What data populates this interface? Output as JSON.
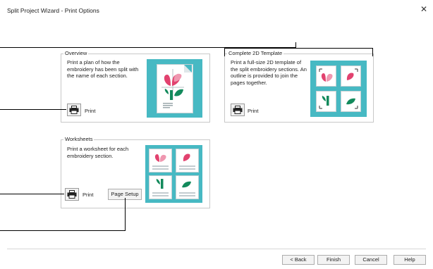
{
  "window": {
    "title": "Split Project Wizard - Print Options",
    "close_glyph": "✕"
  },
  "overview": {
    "label": "Overview",
    "description": "Print a plan of how the embroidery has been split with the name of each section.",
    "print_label": "Print",
    "icon": "printer-icon"
  },
  "template2d": {
    "label": "Complete 2D Template",
    "description": "Print a full-size 2D template of the split embroidery sections. An outline is provided to join the pages together.",
    "print_label": "Print",
    "icon": "printer-icon"
  },
  "worksheets": {
    "label": "Worksheets",
    "description": "Print a worksheet for each embroidery section.",
    "print_label": "Print",
    "page_setup_label": "Page Setup",
    "icon": "printer-icon"
  },
  "footer": {
    "back_label": "< Back",
    "finish_label": "Finish",
    "cancel_label": "Cancel",
    "help_label": "Help"
  },
  "colors": {
    "thumbnail_bg": "#47b9c3",
    "petal_pink": "#e2426f",
    "leaf_green": "#138a5c"
  }
}
